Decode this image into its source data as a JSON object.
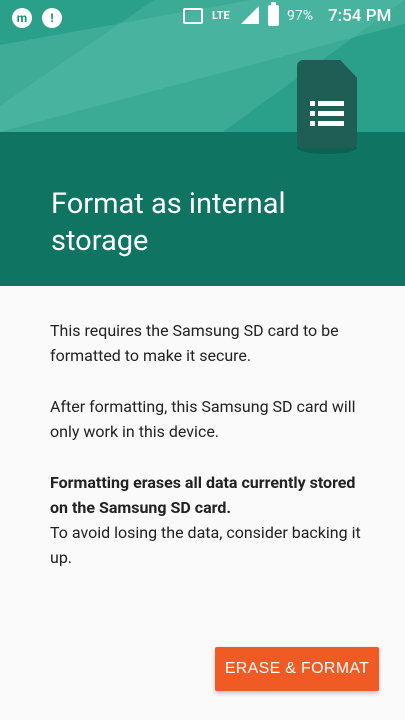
{
  "status_bar": {
    "app_icon_1": "m",
    "app_icon_2": "!",
    "network": "LTE",
    "battery": "97%",
    "time": "7:54 PM"
  },
  "illustration": {
    "icon": "sd-card-icon",
    "color": "#1f5e54"
  },
  "header": {
    "title": "Format as internal storage",
    "colors": {
      "top": "#2aa08a",
      "bottom": "#0f7461"
    }
  },
  "body": {
    "p1": "This requires the Samsung SD card to be formatted to make it secure.",
    "p2": "After formatting, this Samsung SD card will only work in this device.",
    "p3_bold": "Formatting erases all data currently stored on the Samsung SD card.",
    "p3_rest": "To avoid losing the data, consider backing it up."
  },
  "actions": {
    "primary_label": "ERASE & FORMAT",
    "primary_color": "#f05a24"
  }
}
